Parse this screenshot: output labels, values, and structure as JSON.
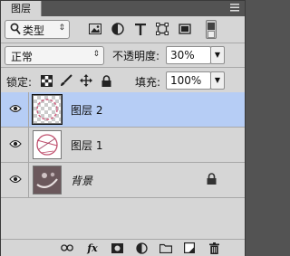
{
  "panel": {
    "tab_label": "图层"
  },
  "filter": {
    "kind_label": "类型"
  },
  "blend": {
    "mode": "正常",
    "opacity_label": "不透明度:",
    "opacity_value": "30%"
  },
  "lock": {
    "label": "锁定:",
    "fill_label": "填充:",
    "fill_value": "100%"
  },
  "layers": [
    {
      "name": "图层 2",
      "selected": true
    },
    {
      "name": "图层 1",
      "selected": false
    },
    {
      "name": "背景",
      "selected": false,
      "locked": true
    }
  ],
  "bottom": {
    "fx_label": "fx"
  },
  "colors": {
    "selection": "#b6cdf5",
    "panel": "#d6d6d6",
    "frame": "#535353"
  }
}
